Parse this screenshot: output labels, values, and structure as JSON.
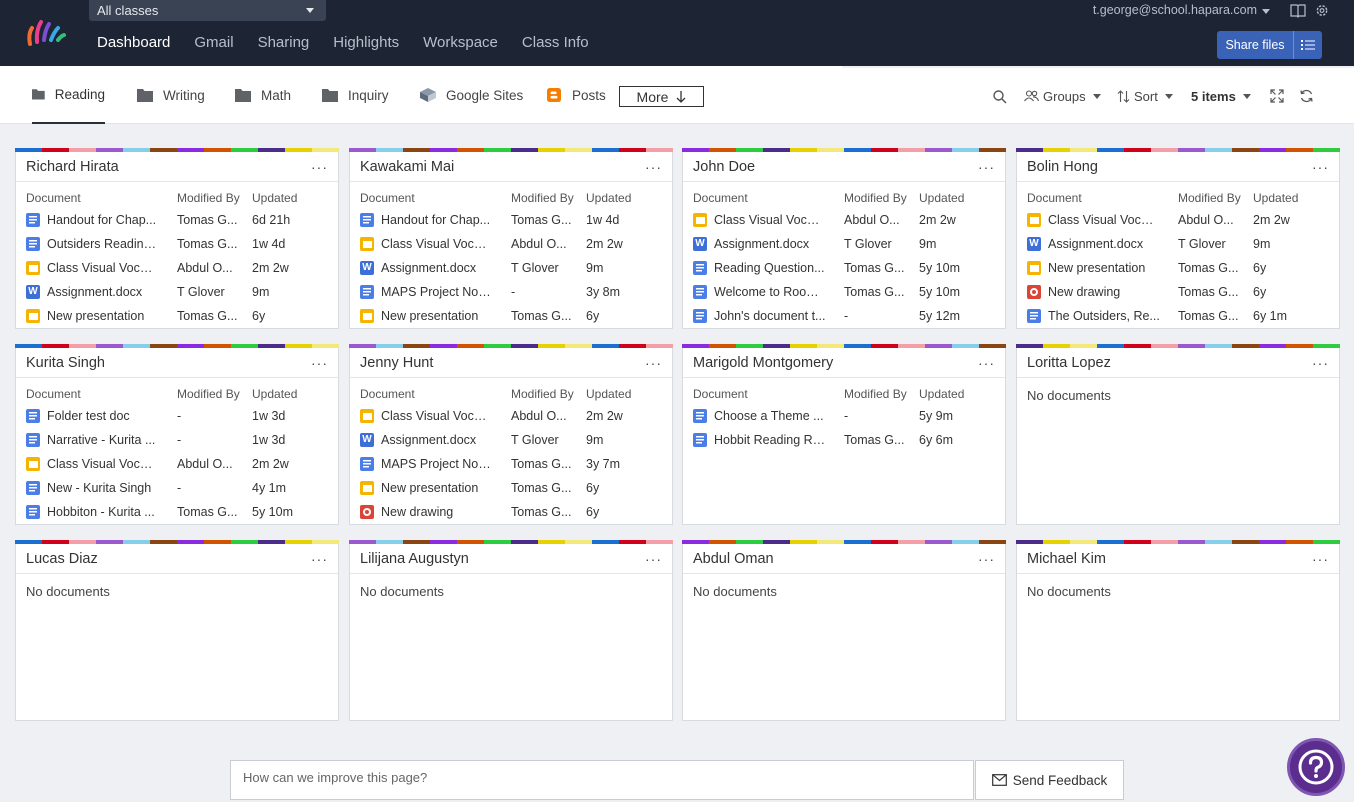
{
  "header": {
    "class_selector": "All classes",
    "nav": [
      "Dashboard",
      "Gmail",
      "Sharing",
      "Highlights",
      "Workspace",
      "Class Info"
    ],
    "active_nav": "Dashboard",
    "user_email": "t.george@school.hapara.com",
    "share_files_label": "Share files"
  },
  "tabs": [
    {
      "label": "Reading",
      "icon": "folder-icon",
      "active": true
    },
    {
      "label": "Writing",
      "icon": "folder-icon",
      "active": false
    },
    {
      "label": "Math",
      "icon": "folder-icon",
      "active": false
    },
    {
      "label": "Inquiry",
      "icon": "folder-icon",
      "active": false
    },
    {
      "label": "Google Sites",
      "icon": "google-sites-icon",
      "active": false
    },
    {
      "label": "Posts",
      "icon": "blogger-icon",
      "active": false
    }
  ],
  "more_label": "More",
  "toolbar": {
    "groups_label": "Groups",
    "sort_label": "Sort",
    "items_label": "5 items"
  },
  "columns": {
    "document": "Document",
    "modified_by": "Modified By",
    "updated": "Updated"
  },
  "empty_text": "No documents",
  "students": [
    {
      "name": "Richard Hirata",
      "docs": [
        {
          "type": "doc",
          "name": "Handout for Chap...",
          "by": "Tomas G...",
          "updated": "6d 21h"
        },
        {
          "type": "doc",
          "name": "Outsiders Reading...",
          "by": "Tomas G...",
          "updated": "1w 4d"
        },
        {
          "type": "slides",
          "name": "Class Visual Vocab...",
          "by": "Abdul O...",
          "updated": "2m 2w"
        },
        {
          "type": "word",
          "name": "Assignment.docx",
          "by": "T Glover",
          "updated": "9m"
        },
        {
          "type": "slides",
          "name": "New presentation",
          "by": "Tomas G...",
          "updated": "6y"
        }
      ]
    },
    {
      "name": "Kawakami Mai",
      "docs": [
        {
          "type": "doc",
          "name": "Handout for Chap...",
          "by": "Tomas G...",
          "updated": "1w 4d"
        },
        {
          "type": "slides",
          "name": "Class Visual Vocab...",
          "by": "Abdul O...",
          "updated": "2m 2w"
        },
        {
          "type": "word",
          "name": "Assignment.docx",
          "by": "T Glover",
          "updated": "9m"
        },
        {
          "type": "doc",
          "name": "MAPS Project Notes",
          "by": "-",
          "updated": "3y 8m"
        },
        {
          "type": "slides",
          "name": "New presentation",
          "by": "Tomas G...",
          "updated": "6y"
        }
      ]
    },
    {
      "name": "John Doe",
      "docs": [
        {
          "type": "slides",
          "name": "Class Visual Vocab...",
          "by": "Abdul O...",
          "updated": "2m 2w"
        },
        {
          "type": "word",
          "name": "Assignment.docx",
          "by": "T Glover",
          "updated": "9m"
        },
        {
          "type": "doc",
          "name": "Reading Question...",
          "by": "Tomas G...",
          "updated": "5y 10m"
        },
        {
          "type": "doc",
          "name": "Welcome to Room...",
          "by": "Tomas G...",
          "updated": "5y 10m"
        },
        {
          "type": "doc",
          "name": "John's document t...",
          "by": "-",
          "updated": "5y 12m"
        }
      ]
    },
    {
      "name": "Bolin Hong",
      "docs": [
        {
          "type": "slides",
          "name": "Class Visual Vocab...",
          "by": "Abdul O...",
          "updated": "2m 2w"
        },
        {
          "type": "word",
          "name": "Assignment.docx",
          "by": "T Glover",
          "updated": "9m"
        },
        {
          "type": "slides",
          "name": "New presentation",
          "by": "Tomas G...",
          "updated": "6y"
        },
        {
          "type": "drawing",
          "name": "New drawing",
          "by": "Tomas G...",
          "updated": "6y"
        },
        {
          "type": "doc",
          "name": "The Outsiders, Re...",
          "by": "Tomas G...",
          "updated": "6y 1m"
        }
      ]
    },
    {
      "name": "Kurita Singh",
      "docs": [
        {
          "type": "doc",
          "name": "Folder test doc",
          "by": "-",
          "updated": "1w 3d"
        },
        {
          "type": "doc",
          "name": "Narrative - Kurita ...",
          "by": "-",
          "updated": "1w 3d"
        },
        {
          "type": "slides",
          "name": "Class Visual Vocab...",
          "by": "Abdul O...",
          "updated": "2m 2w"
        },
        {
          "type": "doc",
          "name": "New - Kurita Singh",
          "by": "-",
          "updated": "4y 1m"
        },
        {
          "type": "doc",
          "name": "Hobbiton - Kurita ...",
          "by": "Tomas G...",
          "updated": "5y 10m"
        }
      ]
    },
    {
      "name": "Jenny Hunt",
      "docs": [
        {
          "type": "slides",
          "name": "Class Visual Vocab...",
          "by": "Abdul O...",
          "updated": "2m 2w"
        },
        {
          "type": "word",
          "name": "Assignment.docx",
          "by": "T Glover",
          "updated": "9m"
        },
        {
          "type": "doc",
          "name": "MAPS Project Notes",
          "by": "Tomas G...",
          "updated": "3y 7m"
        },
        {
          "type": "slides",
          "name": "New presentation",
          "by": "Tomas G...",
          "updated": "6y"
        },
        {
          "type": "drawing",
          "name": "New drawing",
          "by": "Tomas G...",
          "updated": "6y"
        }
      ]
    },
    {
      "name": "Marigold Montgomery",
      "docs": [
        {
          "type": "doc",
          "name": "Choose a Theme ...",
          "by": "-",
          "updated": "5y 9m"
        },
        {
          "type": "doc",
          "name": "Hobbit Reading Re...",
          "by": "Tomas G...",
          "updated": "6y 6m"
        }
      ]
    },
    {
      "name": "Loritta Lopez",
      "docs": []
    },
    {
      "name": "Lucas Diaz",
      "docs": []
    },
    {
      "name": "Lilijana Augustyn",
      "docs": []
    },
    {
      "name": "Abdul Oman",
      "docs": []
    },
    {
      "name": "Michael Kim",
      "docs": []
    }
  ],
  "stripe_colors": [
    "#1b6fd1",
    "#8b4513",
    "#e6d200",
    "#9b59d0",
    "#2ecc40",
    "#d0021b",
    "#8a2be2",
    "#f3e87a",
    "#87ceeb",
    "#4b2c8a",
    "#f4a0a8",
    "#d35400"
  ],
  "feedback": {
    "placeholder": "How can we improve this page?",
    "send_label": "Send Feedback"
  },
  "colors": {
    "topbar": "#1d2534",
    "share_button": "#3a63b8",
    "help_button": "#5b2d8e"
  }
}
